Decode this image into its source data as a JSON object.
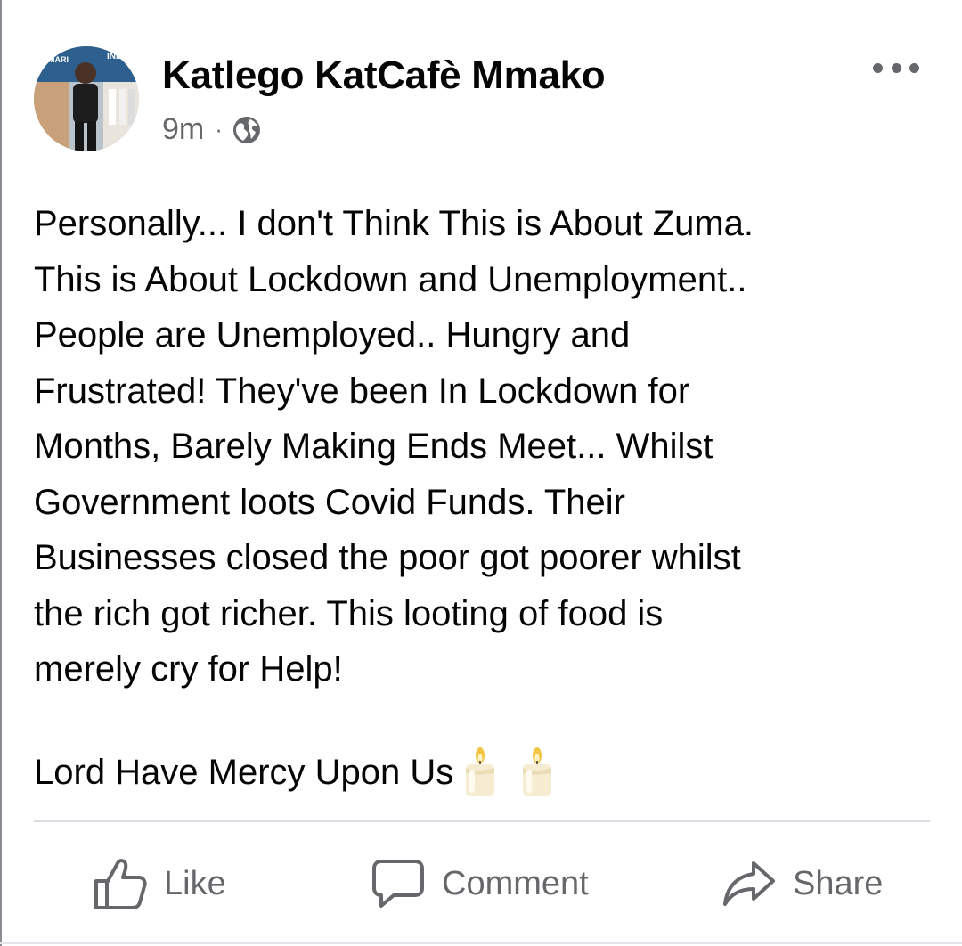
{
  "post": {
    "author": "Katlego KatCafè Mmako",
    "timestamp": "9m",
    "separator": "·",
    "privacy_icon": "globe-icon",
    "more_icon": "more-horizontal-icon",
    "avatar_icon": "avatar-photo",
    "body_lines": [
      "Personally... I don't Think  This is About Zuma.",
      "This is About Lockdown and Unemployment..",
      "People are Unemployed.. Hungry and",
      "Frustrated! They've been In Lockdown for",
      "Months, Barely Making Ends Meet... Whilst",
      "Government loots Covid Funds. Their",
      "Businesses closed the poor got poorer whilst",
      "the rich got richer. This looting of food is",
      "merely cry for Help!"
    ],
    "signoff": "Lord Have Mercy Upon Us",
    "signoff_emoji": "candle-icon"
  },
  "actions": {
    "like_label": "Like",
    "comment_label": "Comment",
    "share_label": "Share"
  },
  "colors": {
    "text": "#050505",
    "secondary_text": "#65676b",
    "divider": "#dadde1",
    "background": "#ffffff"
  }
}
